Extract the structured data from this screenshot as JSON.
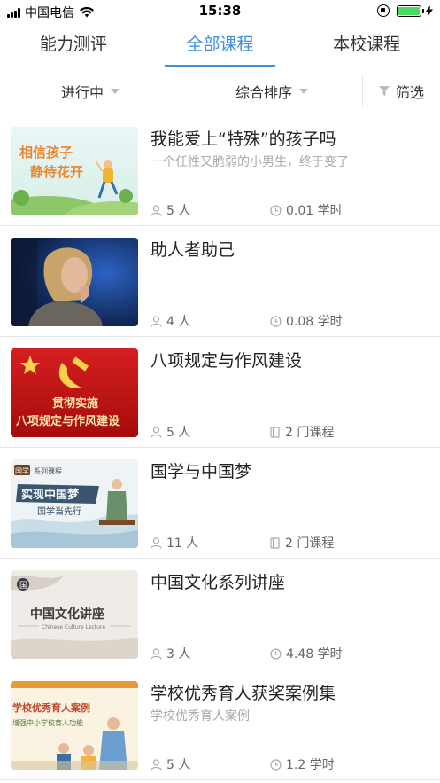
{
  "status_bar": {
    "carrier": "中国电信",
    "time": "15:38"
  },
  "tabs": [
    {
      "label": "能力测评"
    },
    {
      "label": "全部课程",
      "active": true
    },
    {
      "label": "本校课程"
    }
  ],
  "filters": {
    "status": "进行中",
    "sort": "综合排序",
    "filter": "筛选"
  },
  "colors": {
    "accent": "#3b8ee0",
    "battery": "#4cd964"
  },
  "courses": [
    {
      "title": "我能爱上“特殊”的孩子吗",
      "subtitle": "一个任性又脆弱的小男生，终于变了",
      "people": "5 人",
      "stat_icon": "clock-icon",
      "stat": "0.01 学时",
      "thumb_text": [
        "相信孩子",
        "静待花开"
      ]
    },
    {
      "title": "助人者助己",
      "subtitle": "",
      "people": "4 人",
      "stat_icon": "clock-icon",
      "stat": "0.08 学时",
      "thumb_text": []
    },
    {
      "title": "八项规定与作风建设",
      "subtitle": "",
      "people": "5 人",
      "stat_icon": "book-icon",
      "stat": "2 门课程",
      "thumb_text": [
        "贯彻实施",
        "八项规定与作风建设"
      ]
    },
    {
      "title": "国学与中国梦",
      "subtitle": "",
      "people": "11 人",
      "stat_icon": "book-icon",
      "stat": "2 门课程",
      "thumb_text": [
        "国学",
        "系列课程",
        "实现中国梦",
        "国学当先行"
      ]
    },
    {
      "title": "中国文化系列讲座",
      "subtitle": "",
      "people": "3 人",
      "stat_icon": "clock-icon",
      "stat": "4.48 学时",
      "thumb_text": [
        "国",
        "中国文化讲座",
        "Chinese Culture Lecture"
      ]
    },
    {
      "title": "学校优秀育人获奖案例集",
      "subtitle": "学校优秀育人案例",
      "people": "5 人",
      "stat_icon": "clock-icon",
      "stat": "1.2 学时",
      "thumb_text": [
        "学校优秀育人案例",
        "增强中小学校育人功能"
      ]
    }
  ]
}
